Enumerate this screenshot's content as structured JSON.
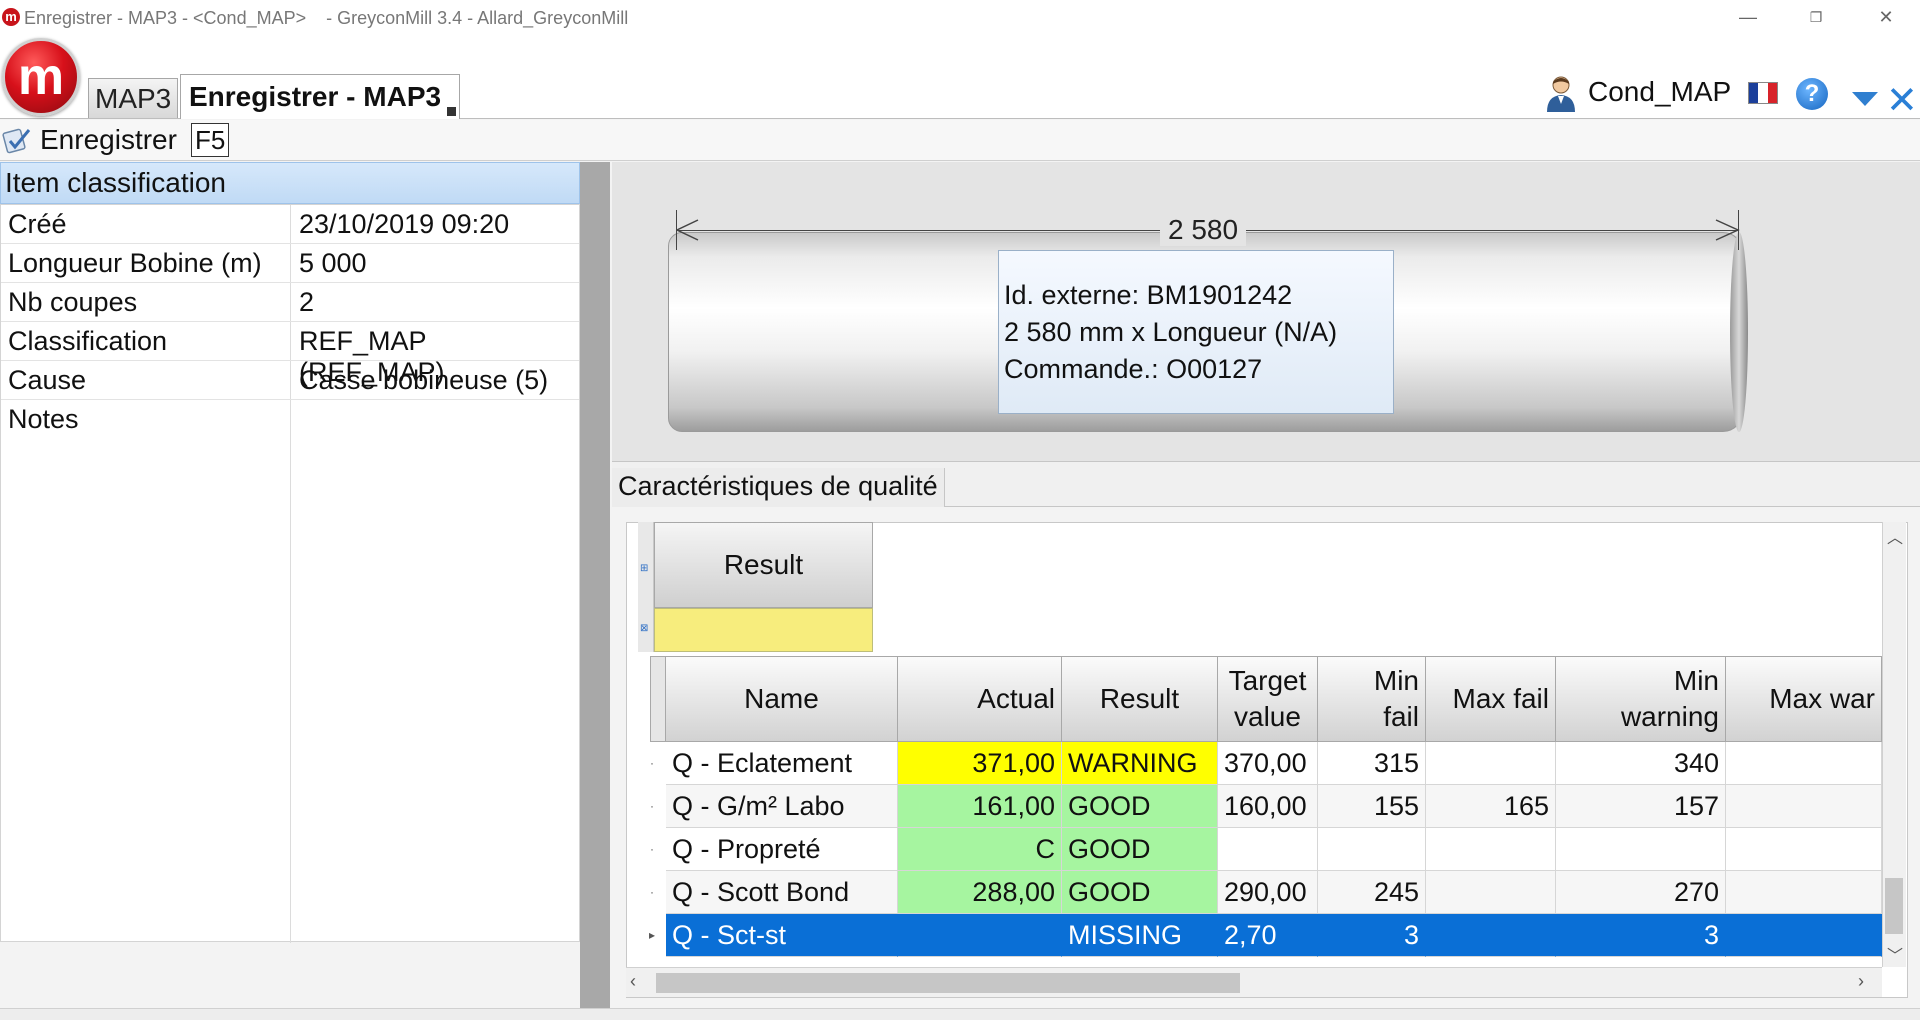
{
  "window": {
    "title": "Enregistrer - MAP3 - <Cond_MAP>    - GreyconMill 3.4 - Allard_GreyconMill",
    "logo_letter": "m",
    "minimize": "—",
    "restore": "❐",
    "close": "✕"
  },
  "header": {
    "app_logo_letter": "m",
    "module_tab": "MAP3",
    "active_tab": "Enregistrer - MAP3",
    "user": "Cond_MAP",
    "help": "?"
  },
  "toolbar": {
    "save_label": "Enregistrer",
    "save_shortcut": "F5"
  },
  "left_panel": {
    "title": "Item classification",
    "properties": [
      {
        "key": "Créé",
        "value": "23/10/2019 09:20"
      },
      {
        "key": "Longueur Bobine (m)",
        "value": "5 000"
      },
      {
        "key": "Nb coupes",
        "value": "2"
      },
      {
        "key": "Classification",
        "value": "REF_MAP (REF_MAP)"
      },
      {
        "key": "Cause",
        "value": "Casse bobineuse (5)"
      },
      {
        "key": "Notes",
        "value": ""
      }
    ]
  },
  "drawing": {
    "width_label": "2 580",
    "info": [
      "Id. externe: BM1901242",
      "2 580 mm x Longueur (N/A)",
      "Commande.: O00127"
    ]
  },
  "quality": {
    "tab_label": "Caractéristiques de qualité",
    "group_header": "Result",
    "columns": [
      "Name",
      "Actual",
      "Result",
      "Target value",
      "Min fail",
      "Max fail",
      "Min warning",
      "Max war"
    ],
    "columns_lines": [
      [
        "Name"
      ],
      [
        "Actual"
      ],
      [
        "Result"
      ],
      [
        "Target",
        "value"
      ],
      [
        "Min",
        "fail"
      ],
      [
        "Max fail"
      ],
      [
        "Min",
        "warning"
      ],
      [
        "Max war"
      ]
    ],
    "rows": [
      {
        "name": "Q - Eclatement",
        "actual": "371,00",
        "result": "WARNING",
        "target": "370,00",
        "min_fail": "315",
        "max_fail": "",
        "min_warning": "340",
        "max_warning": "",
        "status": "warning",
        "selected": false
      },
      {
        "name": "Q - G/m² Labo",
        "actual": "161,00",
        "result": "GOOD",
        "target": "160,00",
        "min_fail": "155",
        "max_fail": "165",
        "min_warning": "157",
        "max_warning": "",
        "status": "good",
        "selected": false
      },
      {
        "name": "Q - Propreté",
        "actual": "C",
        "result": "GOOD",
        "target": "",
        "min_fail": "",
        "max_fail": "",
        "min_warning": "",
        "max_warning": "",
        "status": "good",
        "selected": false
      },
      {
        "name": "Q - Scott Bond",
        "actual": "288,00",
        "result": "GOOD",
        "target": "290,00",
        "min_fail": "245",
        "max_fail": "",
        "min_warning": "270",
        "max_warning": "",
        "status": "good",
        "selected": false
      },
      {
        "name": "Q - Sct-st",
        "actual": "",
        "result": "MISSING",
        "target": "2,70",
        "min_fail": "3",
        "max_fail": "",
        "min_warning": "3",
        "max_warning": "",
        "status": "missing",
        "selected": true
      }
    ]
  },
  "colors": {
    "warning": "#ffff00",
    "good": "#a6f5a0",
    "selected": "#0a6fd6",
    "filter": "#f7ed7d"
  }
}
